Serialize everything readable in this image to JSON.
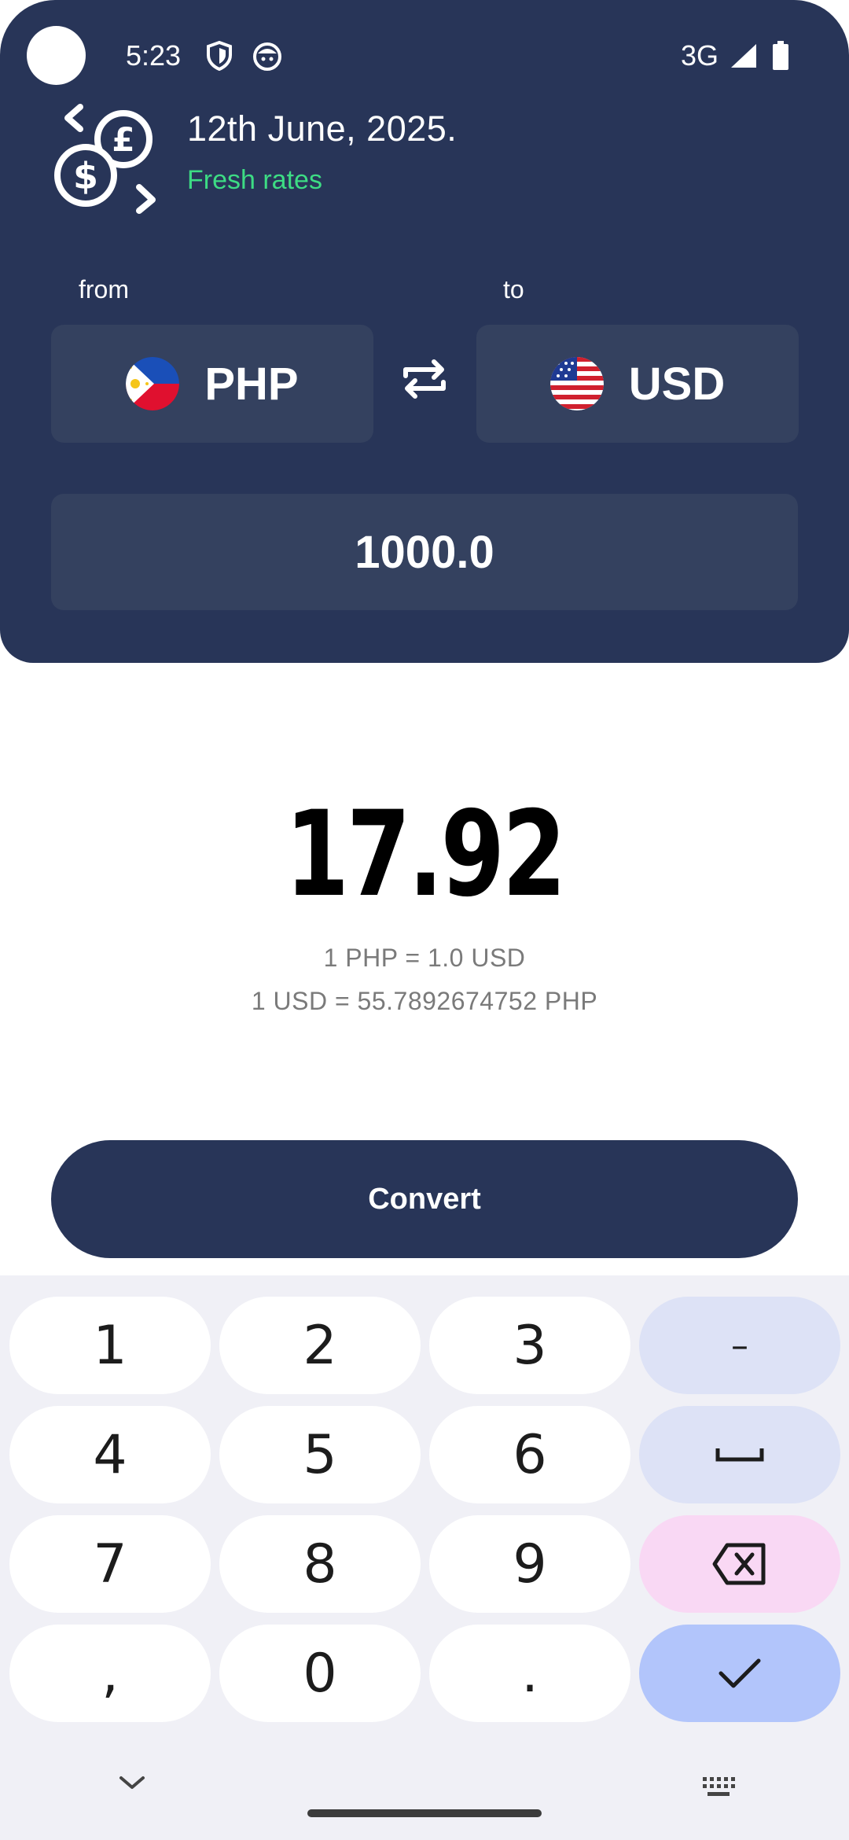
{
  "status_bar": {
    "time": "5:23",
    "network": "3G",
    "icons": [
      "shield-icon",
      "face-icon",
      "signal-icon",
      "battery-icon"
    ]
  },
  "header": {
    "date": "12th June, 2025.",
    "rates_status": "Fresh rates",
    "from_label": "from",
    "to_label": "to",
    "from_currency": "PHP",
    "to_currency": "USD",
    "amount": "1000.0",
    "colors": {
      "panel": "#283558",
      "box": "#34415f",
      "fresh": "#3ddc84"
    }
  },
  "result": {
    "value": "17.92",
    "rate_forward": "1 PHP = 1.0 USD",
    "rate_reverse": "1 USD = 55.7892674752 PHP"
  },
  "convert_label": "Convert",
  "keyboard": {
    "keys": [
      [
        "1",
        "2",
        "3",
        "–"
      ],
      [
        "4",
        "5",
        "6",
        "space"
      ],
      [
        "7",
        "8",
        "9",
        "backspace"
      ],
      [
        ",",
        "0",
        ".",
        "done"
      ]
    ],
    "key1": "1",
    "key2": "2",
    "key3": "3",
    "key_minus": "–",
    "key4": "4",
    "key5": "5",
    "key6": "6",
    "key7": "7",
    "key8": "8",
    "key9": "9",
    "key_comma": ",",
    "key0": "0",
    "key_dot": "."
  }
}
